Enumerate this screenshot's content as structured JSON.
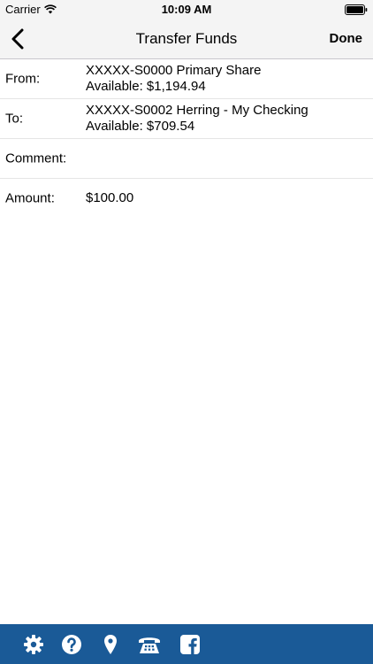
{
  "status_bar": {
    "carrier": "Carrier",
    "time": "10:09 AM"
  },
  "nav": {
    "title": "Transfer Funds",
    "done_label": "Done"
  },
  "form": {
    "from": {
      "label": "From:",
      "account": "XXXXX-S0000 Primary Share",
      "available": "Available: $1,194.94"
    },
    "to": {
      "label": "To:",
      "account": "XXXXX-S0002 Herring - My Checking",
      "available": "Available: $709.54"
    },
    "comment": {
      "label": "Comment:",
      "value": ""
    },
    "amount": {
      "label": "Amount:",
      "value": "$100.00"
    }
  },
  "tab_bar": {
    "background": "#1a5a97",
    "icons": [
      "gear-icon",
      "help-icon",
      "location-pin-icon",
      "phone-icon",
      "facebook-icon"
    ]
  }
}
